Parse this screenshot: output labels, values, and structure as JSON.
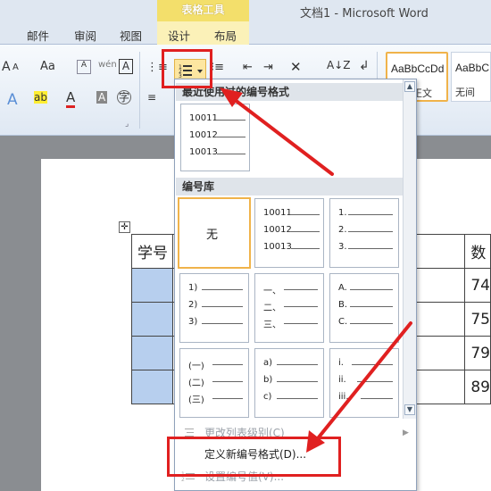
{
  "window": {
    "context_group": "表格工具",
    "doc_title": "文档1 - Microsoft Word"
  },
  "tabs": [
    "邮件",
    "审阅",
    "视图",
    "设计",
    "布局"
  ],
  "ribbon": {
    "font_grow": "A",
    "font_shrink": "A",
    "change_case": "Aa",
    "text_highlight": "ab",
    "font_color": "A",
    "char_shading": "A",
    "enclose_char": "字",
    "sort": "A↓Z"
  },
  "styles_gallery": [
    {
      "sample": "AaBbCcDd",
      "name": "正文"
    },
    {
      "sample": "AaBbC",
      "name": "无间"
    }
  ],
  "document": {
    "header_cells": [
      "学号",
      "数"
    ],
    "values": [
      "74",
      "75",
      "79",
      "89"
    ]
  },
  "dropdown": {
    "recent_heading": "最近使用过的编号格式",
    "library_heading": "编号库",
    "recent_format": [
      "10011",
      "10012",
      "10013"
    ],
    "library": [
      {
        "id": "none",
        "label": "无"
      },
      {
        "id": "numeric-5",
        "lines": [
          "10011",
          "10012",
          "10013"
        ]
      },
      {
        "id": "arabic-dot",
        "lines": [
          "1.",
          "2.",
          "3."
        ]
      },
      {
        "id": "arabic-paren",
        "lines": [
          "1)",
          "2)",
          "3)"
        ]
      },
      {
        "id": "chinese-comma",
        "lines": [
          "一、",
          "二、",
          "三、"
        ]
      },
      {
        "id": "upper-alpha",
        "lines": [
          "A.",
          "B.",
          "C."
        ]
      },
      {
        "id": "chinese-paren",
        "lines": [
          "(一)",
          "(二)",
          "(三)"
        ]
      },
      {
        "id": "lower-alpha",
        "lines": [
          "a)",
          "b)",
          "c)"
        ]
      },
      {
        "id": "roman-lower",
        "lines": [
          "i.",
          "ii.",
          "iii."
        ]
      }
    ],
    "menu": {
      "change_level": "更改列表级别(C)",
      "define_new": "定义新编号格式(D)...",
      "set_value": "设置编号值(V)..."
    }
  },
  "colors": {
    "highlight_box": "#e02020",
    "selected_border": "#f0b34a",
    "table_selection": "#b7cfee"
  }
}
